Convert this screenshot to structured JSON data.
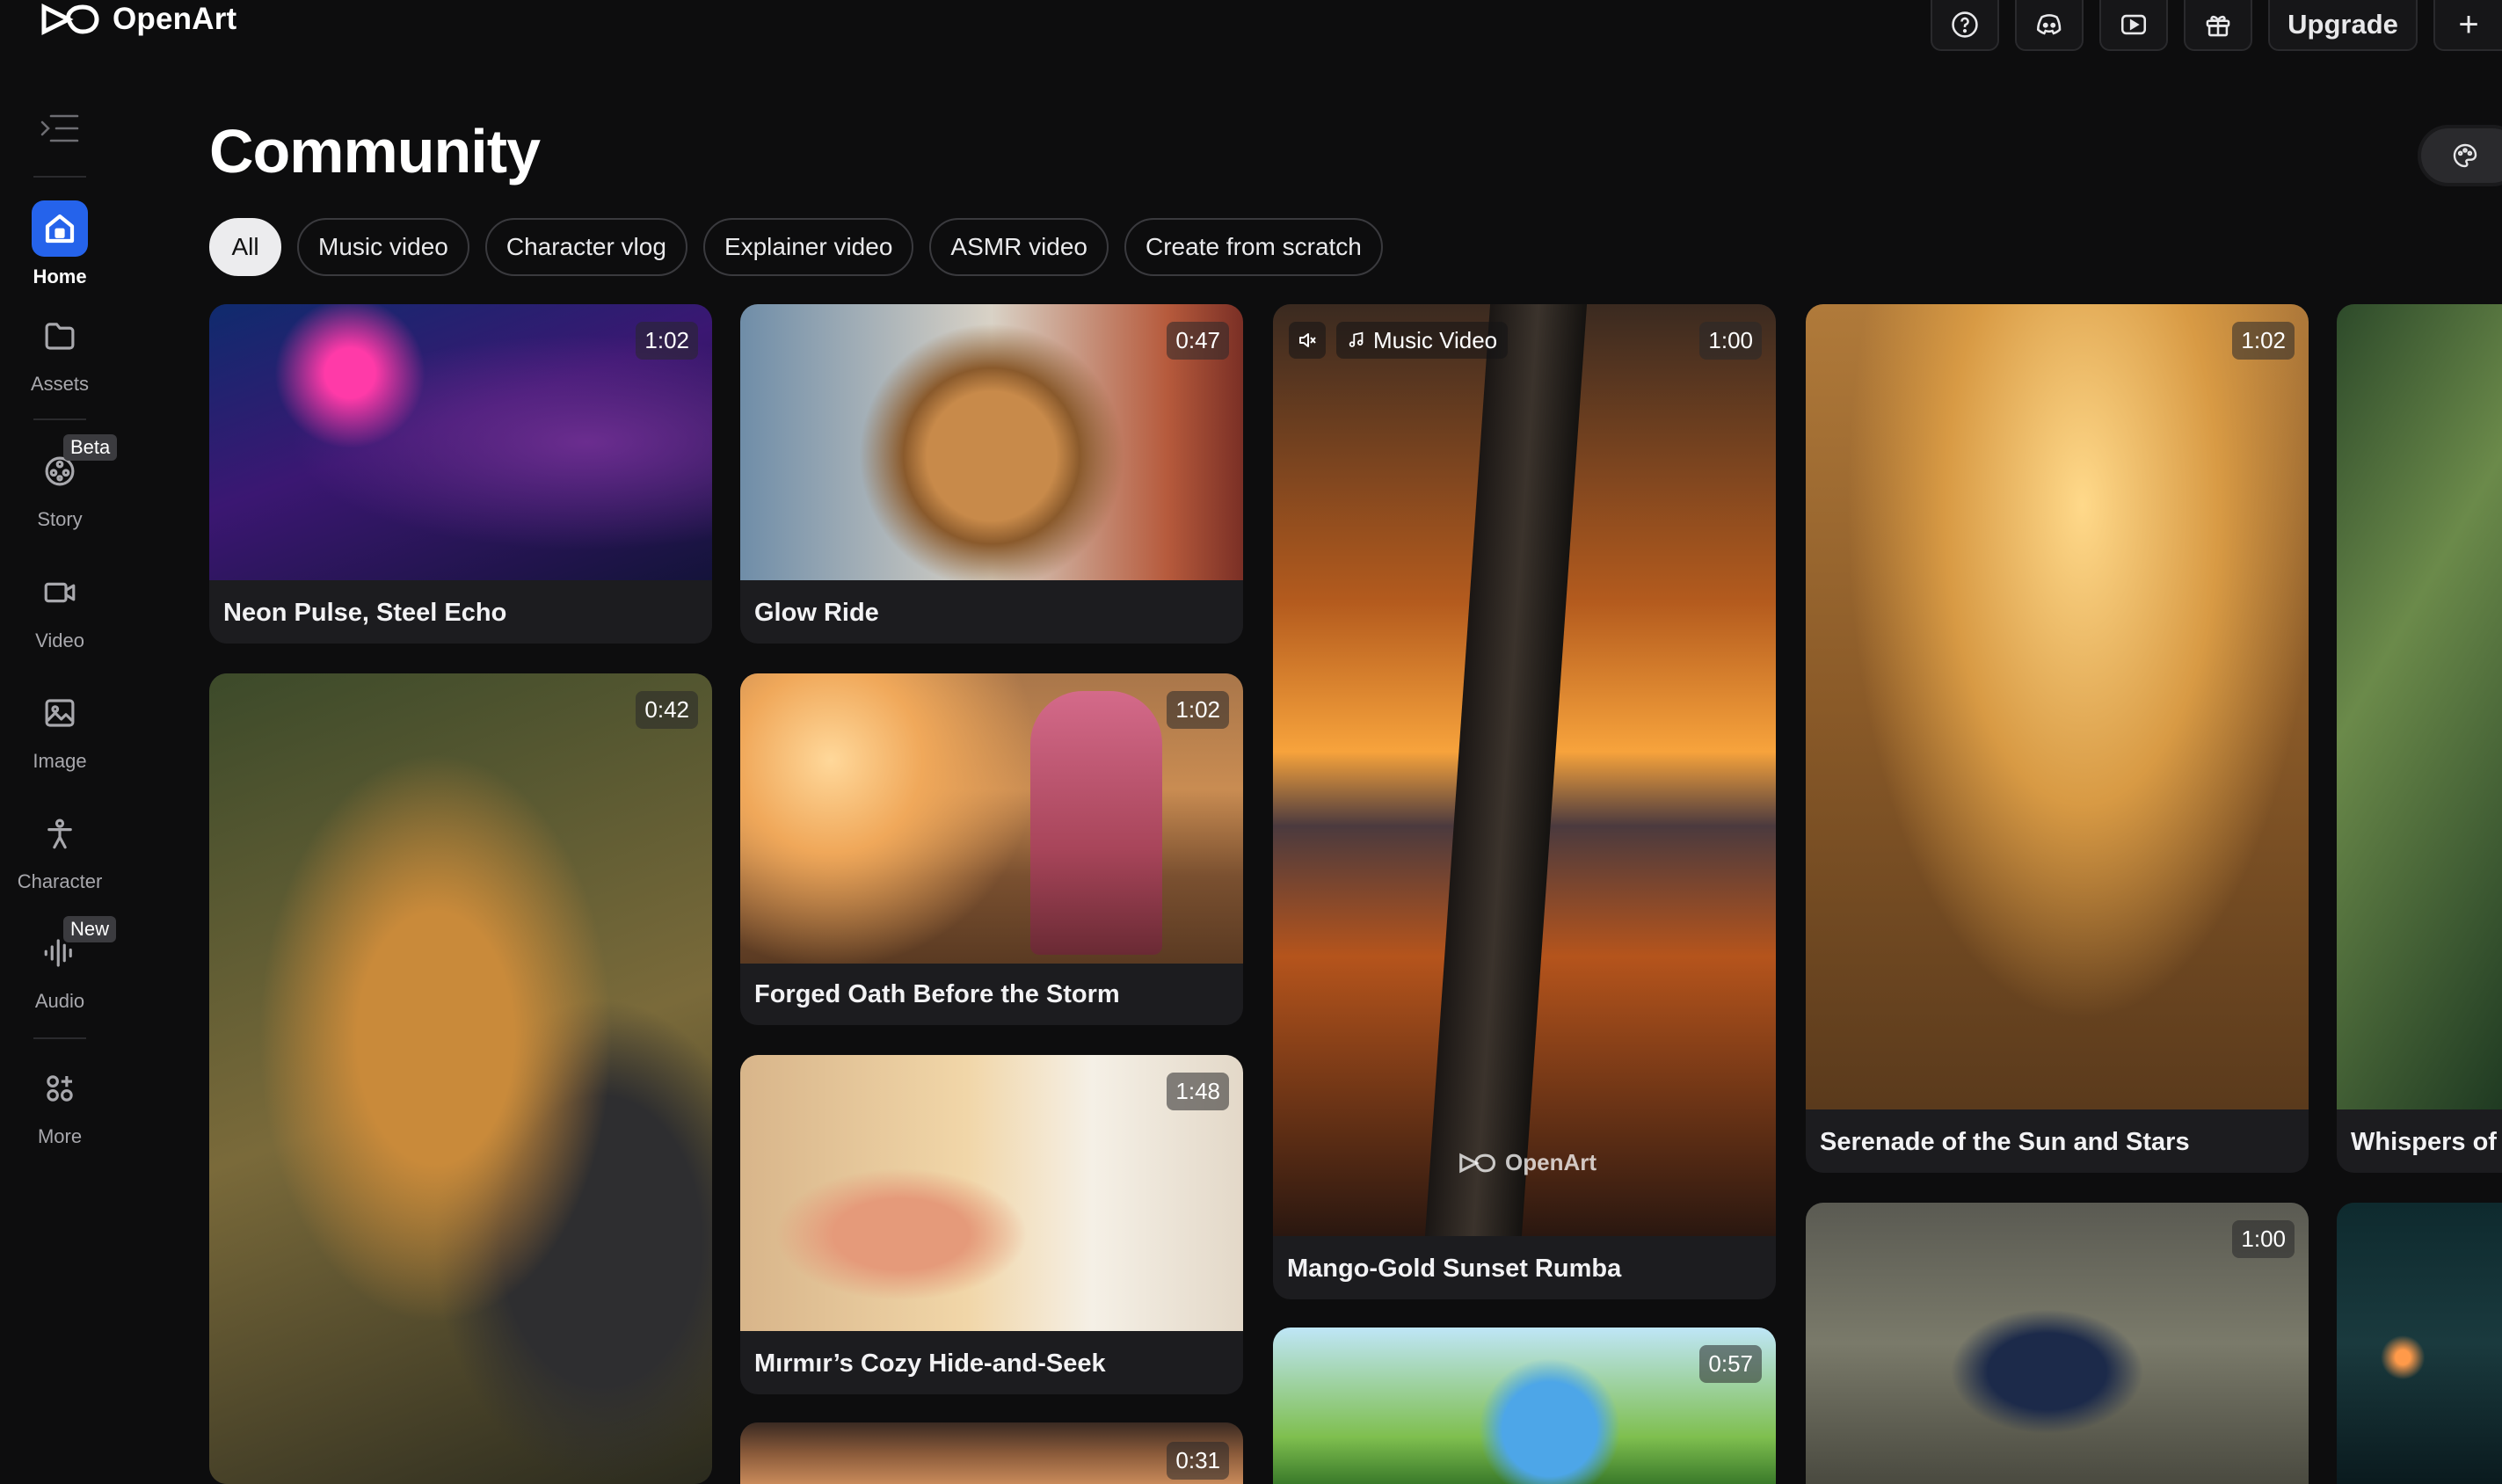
{
  "app": {
    "name": "OpenArt"
  },
  "header": {
    "upgrade_label": "Upgrade",
    "plus_label": "+",
    "icons": [
      "help-icon",
      "discord-icon",
      "youtube-icon",
      "gift-icon"
    ]
  },
  "sidebar": {
    "items": [
      {
        "label": "Home",
        "icon": "home-icon",
        "active": true
      },
      {
        "label": "Assets",
        "icon": "folder-icon"
      },
      {
        "label": "Story",
        "icon": "film-reel-icon",
        "badge": "Beta"
      },
      {
        "label": "Video",
        "icon": "video-camera-icon"
      },
      {
        "label": "Image",
        "icon": "image-icon"
      },
      {
        "label": "Character",
        "icon": "character-icon"
      },
      {
        "label": "Audio",
        "icon": "audio-wave-icon",
        "badge": "New"
      },
      {
        "label": "More",
        "icon": "apps-grid-icon"
      }
    ]
  },
  "main": {
    "title": "Community",
    "filters": [
      "All",
      "Music video",
      "Character vlog",
      "Explainer video",
      "ASMR video",
      "Create from scratch"
    ],
    "active_filter": "All",
    "cards": [
      {
        "title": "Neon Pulse, Steel Echo",
        "duration": "1:02"
      },
      {
        "title": "Glow Ride",
        "duration": "0:47"
      },
      {
        "title": "Mango-Gold Sunset Rumba",
        "duration": "1:00",
        "tag": "Music Video",
        "watermark": "OpenArt"
      },
      {
        "title": "Serenade of the Sun and Stars",
        "duration": "1:02"
      },
      {
        "title": "Whispers of",
        "duration": ""
      },
      {
        "title": "",
        "duration": "0:42"
      },
      {
        "title": "Forged Oath Before the Storm",
        "duration": "1:02"
      },
      {
        "title": "Mırmır’s Cozy Hide-and-Seek",
        "duration": "1:48"
      },
      {
        "title": "",
        "duration": "0:57"
      },
      {
        "title": "",
        "duration": "0:31"
      },
      {
        "title": "",
        "duration": "1:00"
      },
      {
        "title": "",
        "duration": ""
      }
    ]
  },
  "colors": {
    "accent": "#2563eb",
    "background": "#0d0d0e",
    "card": "#1c1c1f"
  }
}
